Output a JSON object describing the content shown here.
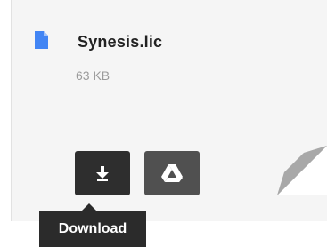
{
  "file": {
    "name": "Synesis.lic",
    "size": "63 KB",
    "icon": "google-doc-file-icon"
  },
  "actions": {
    "download_icon": "download-arrow-icon",
    "drive_icon": "google-drive-icon"
  },
  "tooltip": {
    "text": "Download"
  },
  "colors": {
    "file_icon": "#4285f4",
    "button_dark": "#2e2e2e",
    "button_gray": "#505050",
    "tooltip_bg": "#2b2b2b",
    "card_bg": "#f5f5f5"
  }
}
